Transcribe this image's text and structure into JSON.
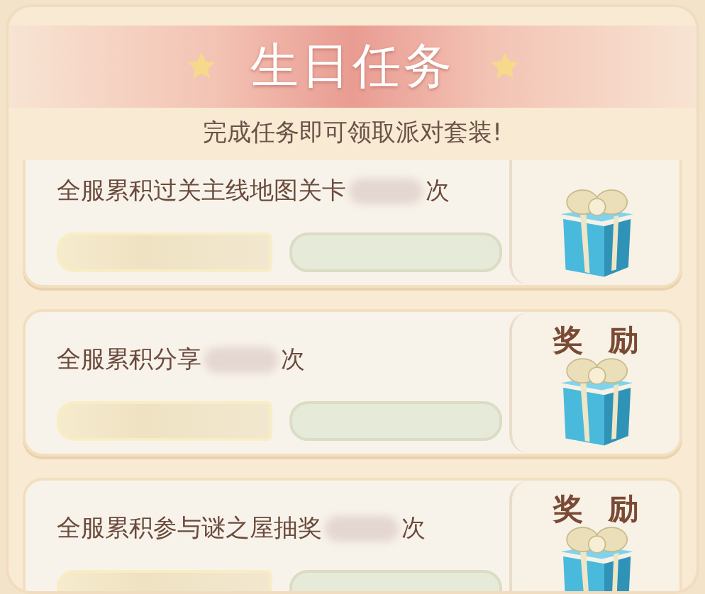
{
  "header": {
    "title": "生日任务",
    "subtitle": "完成任务即可领取派对套装!"
  },
  "tasks": [
    {
      "prefix": "全服累积过关主线地图关卡",
      "suffix": "次",
      "level": 0
    },
    {
      "prefix": "全服累积分享",
      "suffix": "次",
      "reward_label": "奖励",
      "level": 0
    },
    {
      "prefix": "全服累积参与谜之屋抽奖",
      "suffix": "次",
      "reward_label": "奖励",
      "level": 0
    }
  ]
}
